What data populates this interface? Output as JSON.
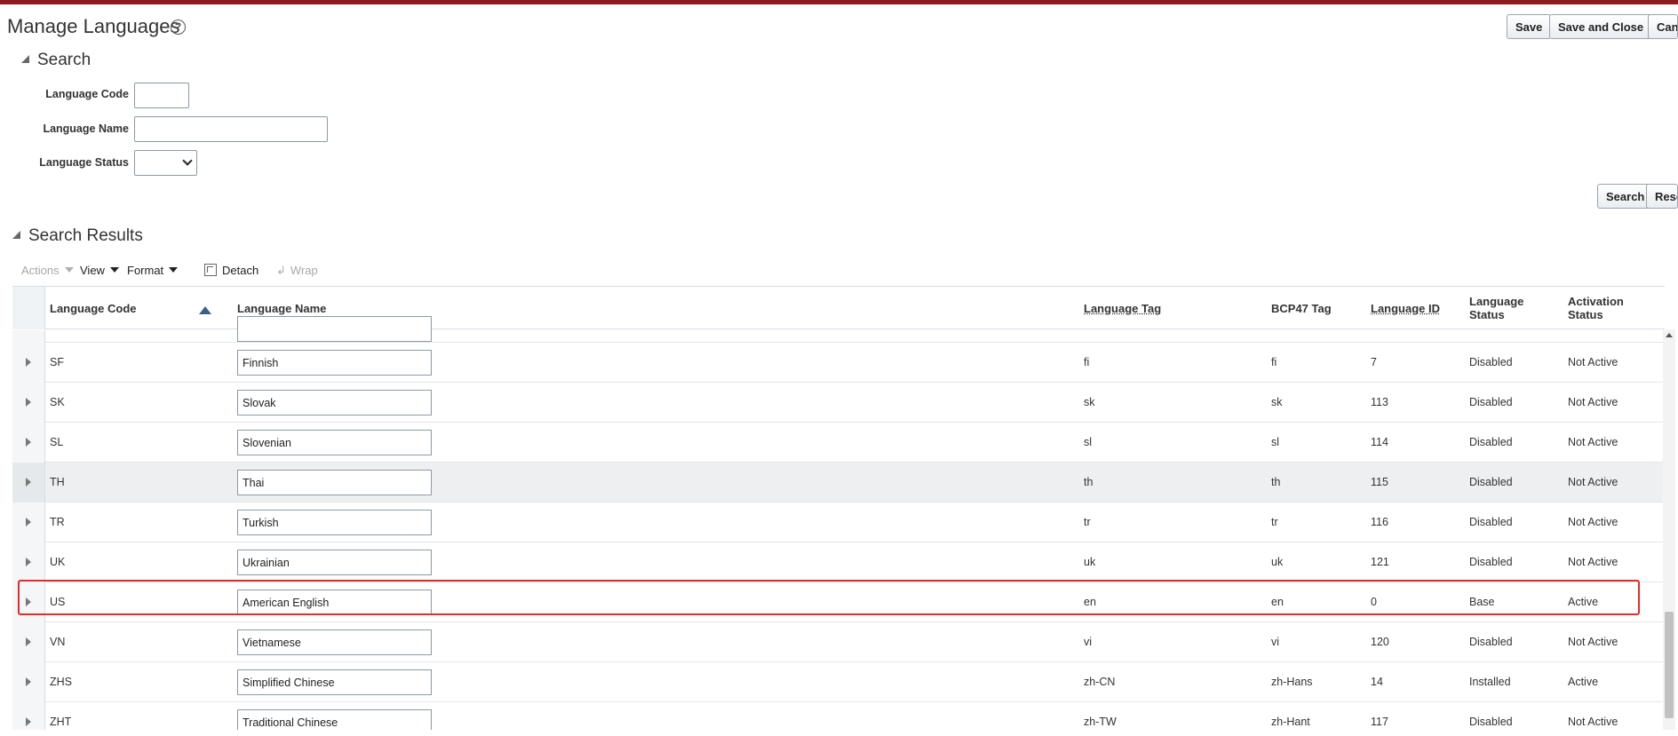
{
  "header": {
    "title": "Manage Languages",
    "help_icon": "?",
    "save_label": "Save",
    "save_close_label": "Save and Close",
    "cancel_label": "Cancel"
  },
  "search": {
    "title": "Search",
    "language_code_label": "Language Code",
    "language_code_value": "",
    "language_name_label": "Language Name",
    "language_name_value": "",
    "language_status_label": "Language Status",
    "language_status_value": "",
    "search_button": "Search",
    "reset_button": "Reset"
  },
  "results": {
    "title": "Search Results",
    "toolbar": {
      "actions": "Actions",
      "view": "View",
      "format": "Format",
      "detach": "Detach",
      "wrap": "Wrap"
    },
    "columns": {
      "code": "Language Code",
      "name": "Language Name",
      "tag": "Language Tag",
      "bcp47": "BCP47 Tag",
      "id": "Language ID",
      "status": "Language Status",
      "activation": "Activation Status"
    },
    "rows": [
      {
        "code": "SF",
        "name": "Finnish",
        "tag": "fi",
        "bcp47": "fi",
        "id": "7",
        "status": "Disabled",
        "activation": "Not Active"
      },
      {
        "code": "SK",
        "name": "Slovak",
        "tag": "sk",
        "bcp47": "sk",
        "id": "113",
        "status": "Disabled",
        "activation": "Not Active"
      },
      {
        "code": "SL",
        "name": "Slovenian",
        "tag": "sl",
        "bcp47": "sl",
        "id": "114",
        "status": "Disabled",
        "activation": "Not Active"
      },
      {
        "code": "TH",
        "name": "Thai",
        "tag": "th",
        "bcp47": "th",
        "id": "115",
        "status": "Disabled",
        "activation": "Not Active"
      },
      {
        "code": "TR",
        "name": "Turkish",
        "tag": "tr",
        "bcp47": "tr",
        "id": "116",
        "status": "Disabled",
        "activation": "Not Active"
      },
      {
        "code": "UK",
        "name": "Ukrainian",
        "tag": "uk",
        "bcp47": "uk",
        "id": "121",
        "status": "Disabled",
        "activation": "Not Active"
      },
      {
        "code": "US",
        "name": "American English",
        "tag": "en",
        "bcp47": "en",
        "id": "0",
        "status": "Base",
        "activation": "Active"
      },
      {
        "code": "VN",
        "name": "Vietnamese",
        "tag": "vi",
        "bcp47": "vi",
        "id": "120",
        "status": "Disabled",
        "activation": "Not Active"
      },
      {
        "code": "ZHS",
        "name": "Simplified Chinese",
        "tag": "zh-CN",
        "bcp47": "zh-Hans",
        "id": "14",
        "status": "Installed",
        "activation": "Active"
      },
      {
        "code": "ZHT",
        "name": "Traditional Chinese",
        "tag": "zh-TW",
        "bcp47": "zh-Hant",
        "id": "117",
        "status": "Disabled",
        "activation": "Not Active"
      }
    ]
  },
  "colors": {
    "brand_bar": "#8e1b1b",
    "highlight_outline": "#e32b2b",
    "sort_icon": "#3a5f8a"
  }
}
